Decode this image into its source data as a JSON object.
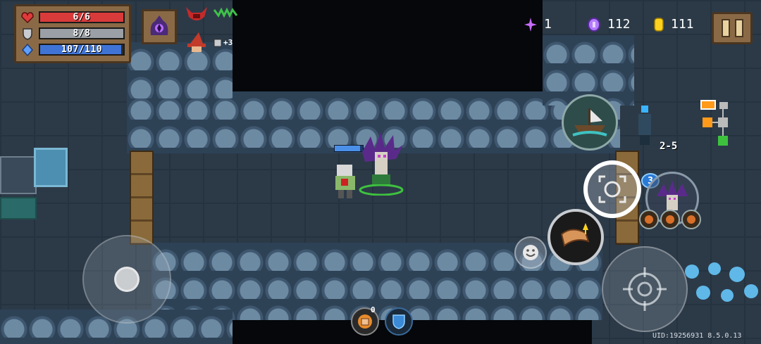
{
  "hud": {
    "health": {
      "text": "6/6",
      "current": 6,
      "max": 6,
      "icon": "heart-icon",
      "color": "#d93b3b"
    },
    "armor": {
      "text": "8/8",
      "current": 8,
      "max": 8,
      "icon": "shield-icon",
      "color": "#9aa0a6"
    },
    "energy": {
      "text": "107/110",
      "current": 107,
      "max": 110,
      "icon": "energy-crystal-icon",
      "color": "#3f74d6"
    },
    "skill_icon": "dark-portal-skill-icon",
    "buffs": [
      "demon-horns-buff-icon",
      "green-wings-buff-icon",
      "wizard-hat-buff-icon",
      "armor-bonus-buff-icon"
    ],
    "buff_bonus_label": "+3"
  },
  "counters": {
    "gems": {
      "value": "1",
      "icon": "purple-sparkle-icon",
      "color": "#c76cff"
    },
    "materials": {
      "value": "112",
      "icon": "purple-coin-icon",
      "color": "#b47bff"
    },
    "gold": {
      "value": "111",
      "icon": "gold-coin-icon",
      "color": "#ffd21f"
    }
  },
  "controls": {
    "pause_icon": "pause-icon",
    "ship_skill_icon": "ship-skill-icon",
    "target_lock_icon": "crosshair-lock-icon",
    "target_lock_count": "3",
    "weapon_swap_icon": "horn-weapon-icon",
    "emote_icon": "smiley-icon",
    "attack_icon": "crosshair-icon",
    "items": [
      "fist-item-icon",
      "shield-item-icon"
    ],
    "item_count": "0"
  },
  "minimap": {
    "level": "2-5"
  },
  "footer": {
    "uid": "UID:19256931 8.5.0.13"
  }
}
